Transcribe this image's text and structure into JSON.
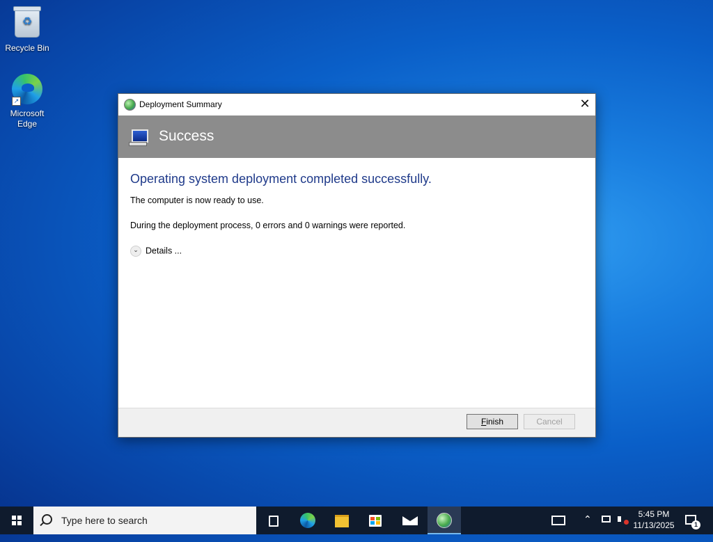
{
  "desktop": {
    "icons": [
      {
        "label": "Recycle Bin",
        "icon": "recycle-bin-icon"
      },
      {
        "label": "Microsoft Edge",
        "icon": "edge-icon"
      }
    ]
  },
  "dialog": {
    "title": "Deployment Summary",
    "close_glyph": "✕",
    "banner_title": "Success",
    "heading": "Operating system deployment completed successfully.",
    "message_ready": "The computer is now ready to use.",
    "message_report": "During the deployment process, 0 errors and 0 warnings were reported.",
    "details_label": "Details ...",
    "buttons": {
      "finish_underlined": "F",
      "finish_rest": "inish",
      "cancel": "Cancel"
    },
    "colors": {
      "banner": "#8c8c8c",
      "heading": "#1f3a8a"
    }
  },
  "taskbar": {
    "search_placeholder": "Type here to search",
    "time": "5:45 PM",
    "date": "11/13/2025",
    "notification_count": "1",
    "pinned": [
      "task-view-icon",
      "edge-icon",
      "file-explorer-icon",
      "store-icon",
      "mail-icon",
      "deployment-app-icon"
    ],
    "active_app": "deployment-app-icon"
  }
}
